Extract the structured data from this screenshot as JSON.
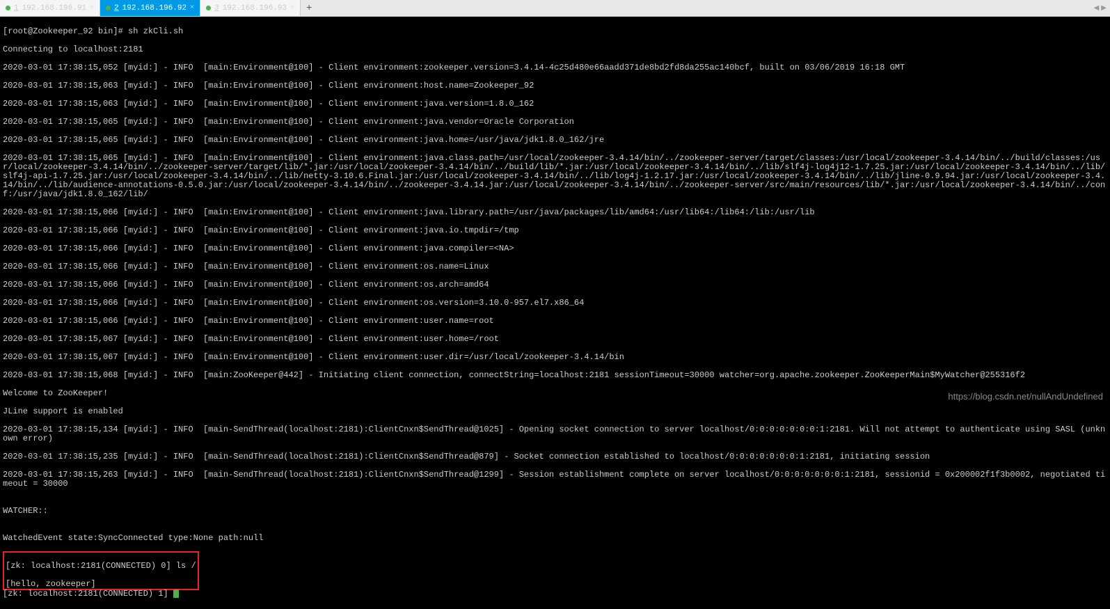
{
  "tabs": [
    {
      "index": "1",
      "label": "192.168.196.91"
    },
    {
      "index": "2",
      "label": "192.168.196.92"
    },
    {
      "index": "3",
      "label": "192.168.196.93"
    }
  ],
  "add_tab": "+",
  "terminal": {
    "prompt": "[root@Zookeeper_92 bin]# sh zkCli.sh",
    "connecting": "Connecting to localhost:2181",
    "lines": [
      "2020-03-01 17:38:15,052 [myid:] - INFO  [main:Environment@100] - Client environment:zookeeper.version=3.4.14-4c25d480e66aadd371de8bd2fd8da255ac140bcf, built on 03/06/2019 16:18 GMT",
      "2020-03-01 17:38:15,063 [myid:] - INFO  [main:Environment@100] - Client environment:host.name=Zookeeper_92",
      "2020-03-01 17:38:15,063 [myid:] - INFO  [main:Environment@100] - Client environment:java.version=1.8.0_162",
      "2020-03-01 17:38:15,065 [myid:] - INFO  [main:Environment@100] - Client environment:java.vendor=Oracle Corporation",
      "2020-03-01 17:38:15,065 [myid:] - INFO  [main:Environment@100] - Client environment:java.home=/usr/java/jdk1.8.0_162/jre",
      "2020-03-01 17:38:15,065 [myid:] - INFO  [main:Environment@100] - Client environment:java.class.path=/usr/local/zookeeper-3.4.14/bin/../zookeeper-server/target/classes:/usr/local/zookeeper-3.4.14/bin/../build/classes:/usr/local/zookeeper-3.4.14/bin/../zookeeper-server/target/lib/*.jar:/usr/local/zookeeper-3.4.14/bin/../build/lib/*.jar:/usr/local/zookeeper-3.4.14/bin/../lib/slf4j-log4j12-1.7.25.jar:/usr/local/zookeeper-3.4.14/bin/../lib/slf4j-api-1.7.25.jar:/usr/local/zookeeper-3.4.14/bin/../lib/netty-3.10.6.Final.jar:/usr/local/zookeeper-3.4.14/bin/../lib/log4j-1.2.17.jar:/usr/local/zookeeper-3.4.14/bin/../lib/jline-0.9.94.jar:/usr/local/zookeeper-3.4.14/bin/../lib/audience-annotations-0.5.0.jar:/usr/local/zookeeper-3.4.14/bin/../zookeeper-3.4.14.jar:/usr/local/zookeeper-3.4.14/bin/../zookeeper-server/src/main/resources/lib/*.jar:/usr/local/zookeeper-3.4.14/bin/../conf:/usr/java/jdk1.8.0_162/lib/",
      "2020-03-01 17:38:15,066 [myid:] - INFO  [main:Environment@100] - Client environment:java.library.path=/usr/java/packages/lib/amd64:/usr/lib64:/lib64:/lib:/usr/lib",
      "2020-03-01 17:38:15,066 [myid:] - INFO  [main:Environment@100] - Client environment:java.io.tmpdir=/tmp",
      "2020-03-01 17:38:15,066 [myid:] - INFO  [main:Environment@100] - Client environment:java.compiler=<NA>",
      "2020-03-01 17:38:15,066 [myid:] - INFO  [main:Environment@100] - Client environment:os.name=Linux",
      "2020-03-01 17:38:15,066 [myid:] - INFO  [main:Environment@100] - Client environment:os.arch=amd64",
      "2020-03-01 17:38:15,066 [myid:] - INFO  [main:Environment@100] - Client environment:os.version=3.10.0-957.el7.x86_64",
      "2020-03-01 17:38:15,066 [myid:] - INFO  [main:Environment@100] - Client environment:user.name=root",
      "2020-03-01 17:38:15,067 [myid:] - INFO  [main:Environment@100] - Client environment:user.home=/root",
      "2020-03-01 17:38:15,067 [myid:] - INFO  [main:Environment@100] - Client environment:user.dir=/usr/local/zookeeper-3.4.14/bin",
      "2020-03-01 17:38:15,068 [myid:] - INFO  [main:ZooKeeper@442] - Initiating client connection, connectString=localhost:2181 sessionTimeout=30000 watcher=org.apache.zookeeper.ZooKeeperMain$MyWatcher@255316f2"
    ],
    "welcome": "Welcome to ZooKeeper!",
    "jline": "JLine support is enabled",
    "session_lines": [
      "2020-03-01 17:38:15,134 [myid:] - INFO  [main-SendThread(localhost:2181):ClientCnxn$SendThread@1025] - Opening socket connection to server localhost/0:0:0:0:0:0:0:1:2181. Will not attempt to authenticate using SASL (unknown error)",
      "2020-03-01 17:38:15,235 [myid:] - INFO  [main-SendThread(localhost:2181):ClientCnxn$SendThread@879] - Socket connection established to localhost/0:0:0:0:0:0:0:1:2181, initiating session",
      "2020-03-01 17:38:15,263 [myid:] - INFO  [main-SendThread(localhost:2181):ClientCnxn$SendThread@1299] - Session establishment complete on server localhost/0:0:0:0:0:0:0:1:2181, sessionid = 0x200002f1f3b0002, negotiated timeout = 30000"
    ],
    "blank": "",
    "watcher": "WATCHER::",
    "watched_event": "WatchedEvent state:SyncConnected type:None path:null",
    "zk_cmd1": "[zk: localhost:2181(CONNECTED) 0] ls /",
    "zk_result": "[hello, zookeeper]",
    "zk_cmd2": "[zk: localhost:2181(CONNECTED) 1] "
  },
  "watermark": "https://blog.csdn.net/nullAndUndefined"
}
